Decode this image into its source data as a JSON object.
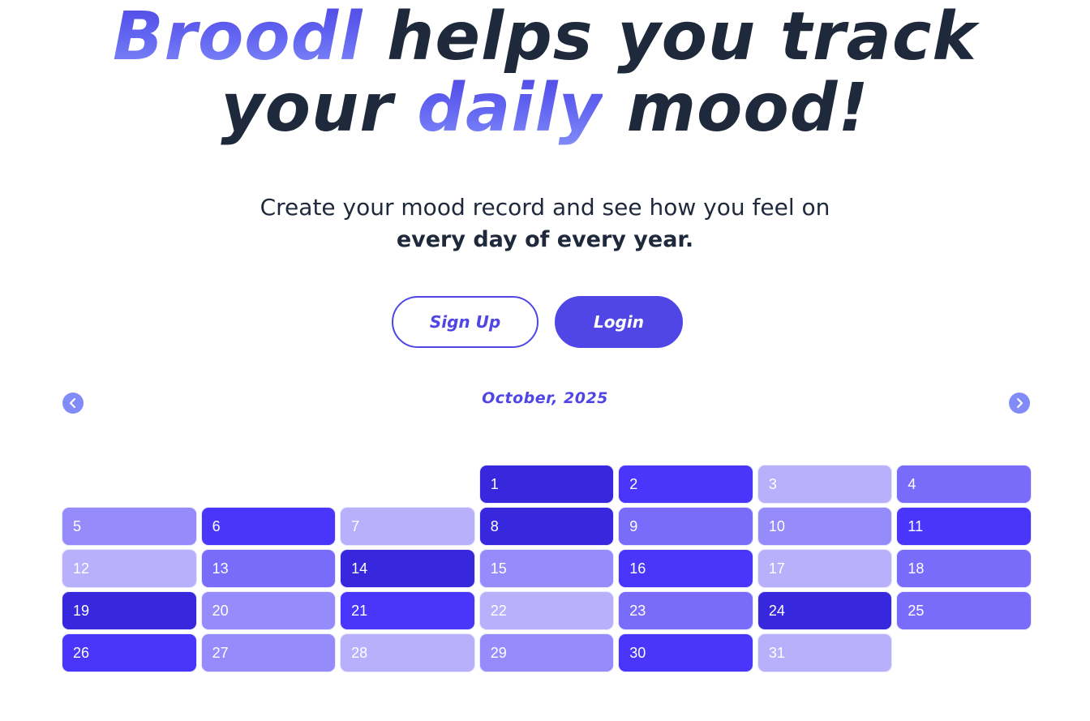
{
  "hero": {
    "brand": "Broodl",
    "line1_rest": " helps you track",
    "line2_a": "your ",
    "line2_highlight": "daily",
    "line2_b": " mood!"
  },
  "subtitle": {
    "line1": "Create your mood record and see how you feel on",
    "line2": "every day of every year."
  },
  "buttons": {
    "signup_label": "Sign Up",
    "login_label": "Login"
  },
  "calendar": {
    "month_label": "October, 2025",
    "prev_icon": "chevron-left-icon",
    "next_icon": "chevron-right-icon",
    "leading_blanks": 3,
    "mood_colors": {
      "1": "#b9b0fc",
      "2": "#958bfb",
      "3": "#7a6cfb",
      "4": "#4a36fb",
      "5": "#3727dd"
    },
    "days": [
      {
        "day": "1",
        "mood": 5
      },
      {
        "day": "2",
        "mood": 4
      },
      {
        "day": "3",
        "mood": 1
      },
      {
        "day": "4",
        "mood": 3
      },
      {
        "day": "5",
        "mood": 2
      },
      {
        "day": "6",
        "mood": 4
      },
      {
        "day": "7",
        "mood": 1
      },
      {
        "day": "8",
        "mood": 5
      },
      {
        "day": "9",
        "mood": 3
      },
      {
        "day": "10",
        "mood": 2
      },
      {
        "day": "11",
        "mood": 4
      },
      {
        "day": "12",
        "mood": 1
      },
      {
        "day": "13",
        "mood": 3
      },
      {
        "day": "14",
        "mood": 5
      },
      {
        "day": "15",
        "mood": 2
      },
      {
        "day": "16",
        "mood": 4
      },
      {
        "day": "17",
        "mood": 1
      },
      {
        "day": "18",
        "mood": 3
      },
      {
        "day": "19",
        "mood": 5
      },
      {
        "day": "20",
        "mood": 2
      },
      {
        "day": "21",
        "mood": 4
      },
      {
        "day": "22",
        "mood": 1
      },
      {
        "day": "23",
        "mood": 3
      },
      {
        "day": "24",
        "mood": 5
      },
      {
        "day": "25",
        "mood": 3
      },
      {
        "day": "26",
        "mood": 4
      },
      {
        "day": "27",
        "mood": 2
      },
      {
        "day": "28",
        "mood": 1
      },
      {
        "day": "29",
        "mood": 2
      },
      {
        "day": "30",
        "mood": 4
      },
      {
        "day": "31",
        "mood": 1
      }
    ]
  }
}
